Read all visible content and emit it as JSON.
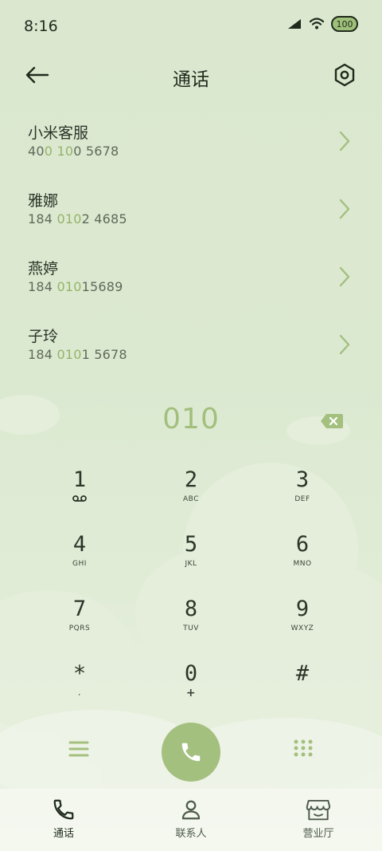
{
  "status_bar": {
    "time": "8:16",
    "battery": "100",
    "icons": [
      "signal-icon",
      "wifi-icon",
      "battery-icon"
    ]
  },
  "header": {
    "title": "通话",
    "back_icon": "arrow-left-icon",
    "settings_icon": "hexagon-settings-icon"
  },
  "contacts": [
    {
      "name": "小米客服",
      "number_parts": [
        "40",
        "0",
        " ",
        "10",
        "0 5678"
      ]
    },
    {
      "name": "雅娜",
      "number_parts": [
        "184 ",
        "010",
        "2 4685"
      ]
    },
    {
      "name": "燕婷",
      "number_parts": [
        "184 ",
        "010",
        "15689"
      ]
    },
    {
      "name": "子玲",
      "number_parts": [
        "184 ",
        "010",
        "1 5678"
      ]
    }
  ],
  "dial": {
    "input": "010"
  },
  "keypad": [
    {
      "digit": "1",
      "letters": "",
      "sub_icon": "voicemail-icon"
    },
    {
      "digit": "2",
      "letters": "ABC"
    },
    {
      "digit": "3",
      "letters": "DEF"
    },
    {
      "digit": "4",
      "letters": "GHI"
    },
    {
      "digit": "5",
      "letters": "JKL"
    },
    {
      "digit": "6",
      "letters": "MNO"
    },
    {
      "digit": "7",
      "letters": "PQRS"
    },
    {
      "digit": "8",
      "letters": "TUV"
    },
    {
      "digit": "9",
      "letters": "WXYZ"
    },
    {
      "digit": "*",
      "letters": ","
    },
    {
      "digit": "0",
      "letters": "+"
    },
    {
      "digit": "#",
      "letters": ""
    }
  ],
  "actions": {
    "menu_icon": "hamburger-menu-icon",
    "call_icon": "phone-icon",
    "dialpad_icon": "dialpad-grid-icon"
  },
  "bottom_nav": [
    {
      "label": "通话",
      "icon": "phone-icon",
      "active": true
    },
    {
      "label": "联系人",
      "icon": "person-icon",
      "active": false
    },
    {
      "label": "营业厅",
      "icon": "store-icon",
      "active": false
    }
  ],
  "colors": {
    "accent": "#a4c07f",
    "highlight": "#93b46a",
    "background": "#dbe8cf",
    "text": "#2f3a2b"
  }
}
